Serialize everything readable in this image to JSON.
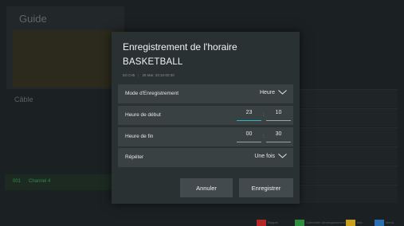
{
  "background": {
    "title": "Guide",
    "source": "Câble",
    "channel_number": "001",
    "channel_name": "Channel 4",
    "legend": [
      {
        "label": "Rappel",
        "color": "#b42525"
      },
      {
        "label": "Calendrier d'enregistrement",
        "color": "#2f8c3f"
      },
      {
        "label": "Info",
        "color": "#c8a020"
      },
      {
        "label": "Menu",
        "color": "#2b6fb0"
      }
    ]
  },
  "dialog": {
    "title": "Enregistrement de l'horaire",
    "program": "BASKETBALL",
    "channel": "53 CH5",
    "datetime": "26 Mar. 23:10-00:30",
    "mode": {
      "label": "Mode d'Enregistrement",
      "value": "Heure"
    },
    "start": {
      "label": "Heure de début",
      "hour": "23",
      "minute": "10",
      "separator": ":"
    },
    "end": {
      "label": "Heure de fin",
      "hour": "00",
      "minute": "30",
      "separator": ":"
    },
    "repeat": {
      "label": "Répéter",
      "value": "Une fois"
    },
    "cancel_label": "Annuler",
    "record_label": "Enregistrer"
  },
  "colors": {
    "accent": "#26b7c6",
    "dialog_bg": "#2a3133",
    "row_bg": "#394143"
  }
}
